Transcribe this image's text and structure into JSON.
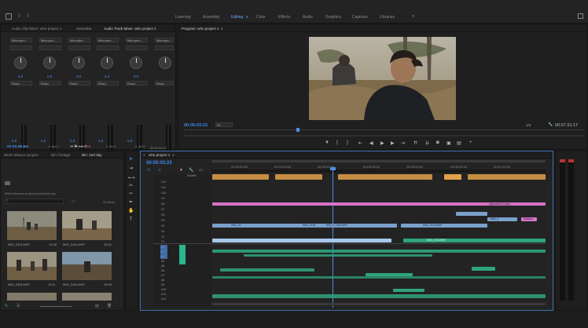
{
  "workspaces": [
    "Learning",
    "Assembly",
    "Editing",
    "Color",
    "Effects",
    "Audio",
    "Graphics",
    "Captions",
    "Libraries"
  ],
  "active_workspace": "Editing",
  "mixer_tabs": [
    "Audio Clip Mixer: who project 1",
    "Metadata",
    "Audio Track Mixer: who project 1"
  ],
  "mixer": {
    "channels": [
      {
        "input": "Micropho...",
        "mode": "Read",
        "value": "0.0",
        "name": "Audio 1",
        "id": "A1"
      },
      {
        "input": "Micropho...",
        "mode": "Read",
        "value": "0.0",
        "name": "Audio 2",
        "id": "A2"
      },
      {
        "input": "Micropho...",
        "mode": "Read",
        "value": "0.0",
        "name": "Audio 3",
        "id": "A3"
      },
      {
        "input": "Micropho...",
        "mode": "Read",
        "value": "0.0",
        "name": "Audio 4",
        "id": "A4"
      },
      {
        "input": "Micropho...",
        "mode": "Read",
        "value": "0.0",
        "name": "Audio 5",
        "id": "A5"
      },
      {
        "input": "Micropho...",
        "mode": "Read",
        "value": "0.0",
        "name": "Audio 6",
        "id": "A6"
      }
    ],
    "mix_label": "Mix",
    "timecode_left": "00:05:03:23",
    "timecode_right": "00:07:31:17"
  },
  "program": {
    "title": "Program: who project 1",
    "timecode": "00:05:03:23",
    "fit": "Fit",
    "quality": "1/4",
    "duration": "00:07:31:17"
  },
  "project": {
    "tabs": [
      "WHO tobacco project",
      "Bin: footage",
      "Bin: 2nd day"
    ],
    "path": "WHO tobacco project.prproj\\2nd day",
    "items_count": "32 items",
    "clips": [
      {
        "name": "IMG_0113.MXF",
        "dur": "12:16"
      },
      {
        "name": "IMG_0114.MXF",
        "dur": "10:01"
      },
      {
        "name": "IMG_0115.MXF",
        "dur": "8:14"
      },
      {
        "name": "IMG_0116.MXF",
        "dur": "10:09"
      }
    ]
  },
  "timeline": {
    "tab": "who project 1",
    "timecode": "00:05:03:23",
    "ruler": [
      "00:04:00:00",
      "00:04:30:00",
      "00:05:00:00",
      "00:05:30:00",
      "00:06:00:00",
      "00:06:30:00",
      "00:07:00:00"
    ],
    "video_tracks": [
      "Subtitle",
      "V12",
      "V11",
      "V10",
      "V9",
      "V8",
      "V7",
      "V6",
      "V5",
      "V4",
      "V3",
      "V2",
      "V1"
    ],
    "audio_tracks": [
      "A1",
      "A2",
      "A3",
      "A4",
      "A5",
      "A6",
      "A7",
      "A8",
      "A9",
      "A10",
      "A11",
      "A12",
      "A13"
    ],
    "clip_labels": [
      "IMG_01",
      "IMG_0",
      "IMG_0117",
      "IMG_0118",
      "IMG_0_Dup.MXF",
      "IMG_0",
      "IMG_0",
      "IMG_0114.MXF",
      "Adjustment Layer",
      "IMG_0",
      "IMG_0114.MXF",
      "Tobacco"
    ]
  },
  "colors": {
    "accent": "#4d8fe3",
    "audio": "#2fa47c",
    "video": "#7aa0cc",
    "subtitle": "#e4a049",
    "adjustment": "#d873c8"
  }
}
